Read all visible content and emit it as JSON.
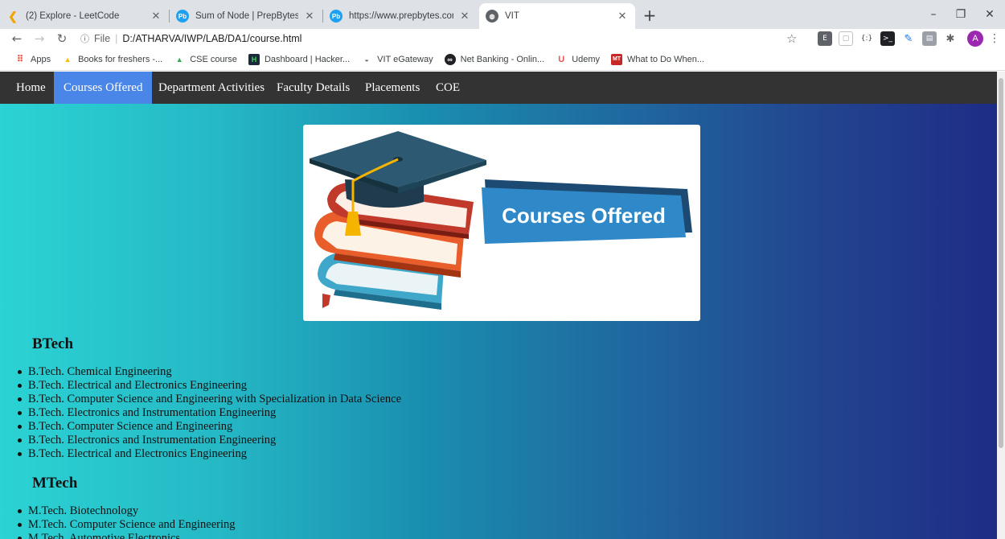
{
  "browser": {
    "tabs": [
      {
        "title": "(2) Explore - LeetCode",
        "icon": "leetcode-icon"
      },
      {
        "title": "Sum of Node | PrepBytes",
        "icon": "prepbytes-icon"
      },
      {
        "title": "https://www.prepbytes.com/pane",
        "icon": "prepbytes-icon"
      },
      {
        "title": "VIT",
        "icon": "globe-icon",
        "active": true
      }
    ],
    "new_tab": "+",
    "address": {
      "info": "ⓘ",
      "scheme": "File",
      "path": "D:/ATHARVA/IWP/LAB/DA1/course.html"
    },
    "profile_initial": "A",
    "bookmarks": [
      {
        "label": "Apps",
        "icon": "apps-grid-icon"
      },
      {
        "label": "Books for freshers -...",
        "icon": "google-drive-icon"
      },
      {
        "label": "CSE course",
        "icon": "google-drive-icon"
      },
      {
        "label": "Dashboard | Hacker...",
        "icon": "hackerrank-icon"
      },
      {
        "label": "VIT eGateway",
        "icon": "vit-icon"
      },
      {
        "label": "Net Banking - Onlin...",
        "icon": "bank-icon"
      },
      {
        "label": "Udemy",
        "icon": "udemy-icon"
      },
      {
        "label": "What to Do When...",
        "icon": "mt-icon"
      }
    ],
    "colors": {
      "tabstrip": "#dee1e6",
      "avatar": "#9c27b0"
    }
  },
  "site_nav": {
    "items": [
      {
        "label": "Home"
      },
      {
        "label": "Courses Offered",
        "active": true
      },
      {
        "label": "Department Activities"
      },
      {
        "label": "Faculty Details"
      },
      {
        "label": "Placements"
      },
      {
        "label": "COE"
      }
    ],
    "colors": {
      "bar": "#333333",
      "active": "#4a86e8"
    }
  },
  "hero": {
    "banner_text": "Courses Offered"
  },
  "sections": [
    {
      "heading": "BTech",
      "courses": [
        "B.Tech. Chemical Engineering",
        "B.Tech. Electrical and Electronics Engineering",
        "B.Tech. Computer Science and Engineering with Specialization in Data Science",
        "B.Tech. Electronics and Instrumentation Engineering",
        "B.Tech. Computer Science and Engineering",
        "B.Tech. Electronics and Instrumentation Engineering",
        "B.Tech. Electrical and Electronics Engineering"
      ]
    },
    {
      "heading": "MTech",
      "courses": [
        "M.Tech. Biotechnology",
        "M.Tech. Computer Science and Engineering",
        "M.Tech. Automotive Electronics"
      ]
    }
  ]
}
